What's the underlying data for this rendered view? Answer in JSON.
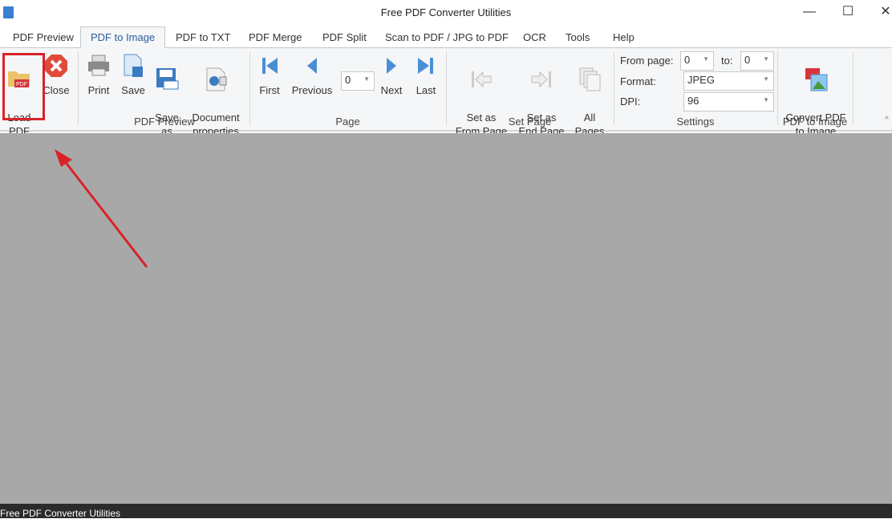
{
  "window": {
    "title": "Free PDF Converter Utilities",
    "minimize": "—",
    "maximize": "☐",
    "close": "✕"
  },
  "tabs": [
    {
      "label": "PDF Preview"
    },
    {
      "label": "PDF to Image"
    },
    {
      "label": "PDF to TXT"
    },
    {
      "label": "PDF Merge"
    },
    {
      "label": "PDF Split"
    },
    {
      "label": "Scan to PDF / JPG to PDF"
    },
    {
      "label": "OCR"
    },
    {
      "label": "Tools"
    },
    {
      "label": "Help"
    }
  ],
  "ribbon": {
    "preview": {
      "group": "PDF Preview",
      "load": "Load\nPDF",
      "close": "Close",
      "print": "Print",
      "save": "Save",
      "save_as": "Save\nas",
      "doc_props": "Document\nproperties"
    },
    "page": {
      "group": "Page",
      "first": "First",
      "previous": "Previous",
      "page_value": "0",
      "next": "Next",
      "last": "Last"
    },
    "set_page": {
      "group": "Set Page",
      "from": "Set as\nFrom Page",
      "end": "Set as\nEnd Page",
      "all": "All\nPages"
    },
    "settings": {
      "group": "Settings",
      "from_label": "From page:",
      "from_value": "0",
      "to_label": "to:",
      "to_value": "0",
      "format_label": "Format:",
      "format_value": "JPEG",
      "dpi_label": "DPI:",
      "dpi_value": "96"
    },
    "convert": {
      "group": "PDF to Image",
      "button": "Convert PDF\nto Image"
    }
  },
  "status": {
    "text": "Free PDF Converter Utilities"
  },
  "colors": {
    "accent": "#2c5d9e",
    "highlight": "#d8232a",
    "canvas": "#a9a8a9"
  }
}
